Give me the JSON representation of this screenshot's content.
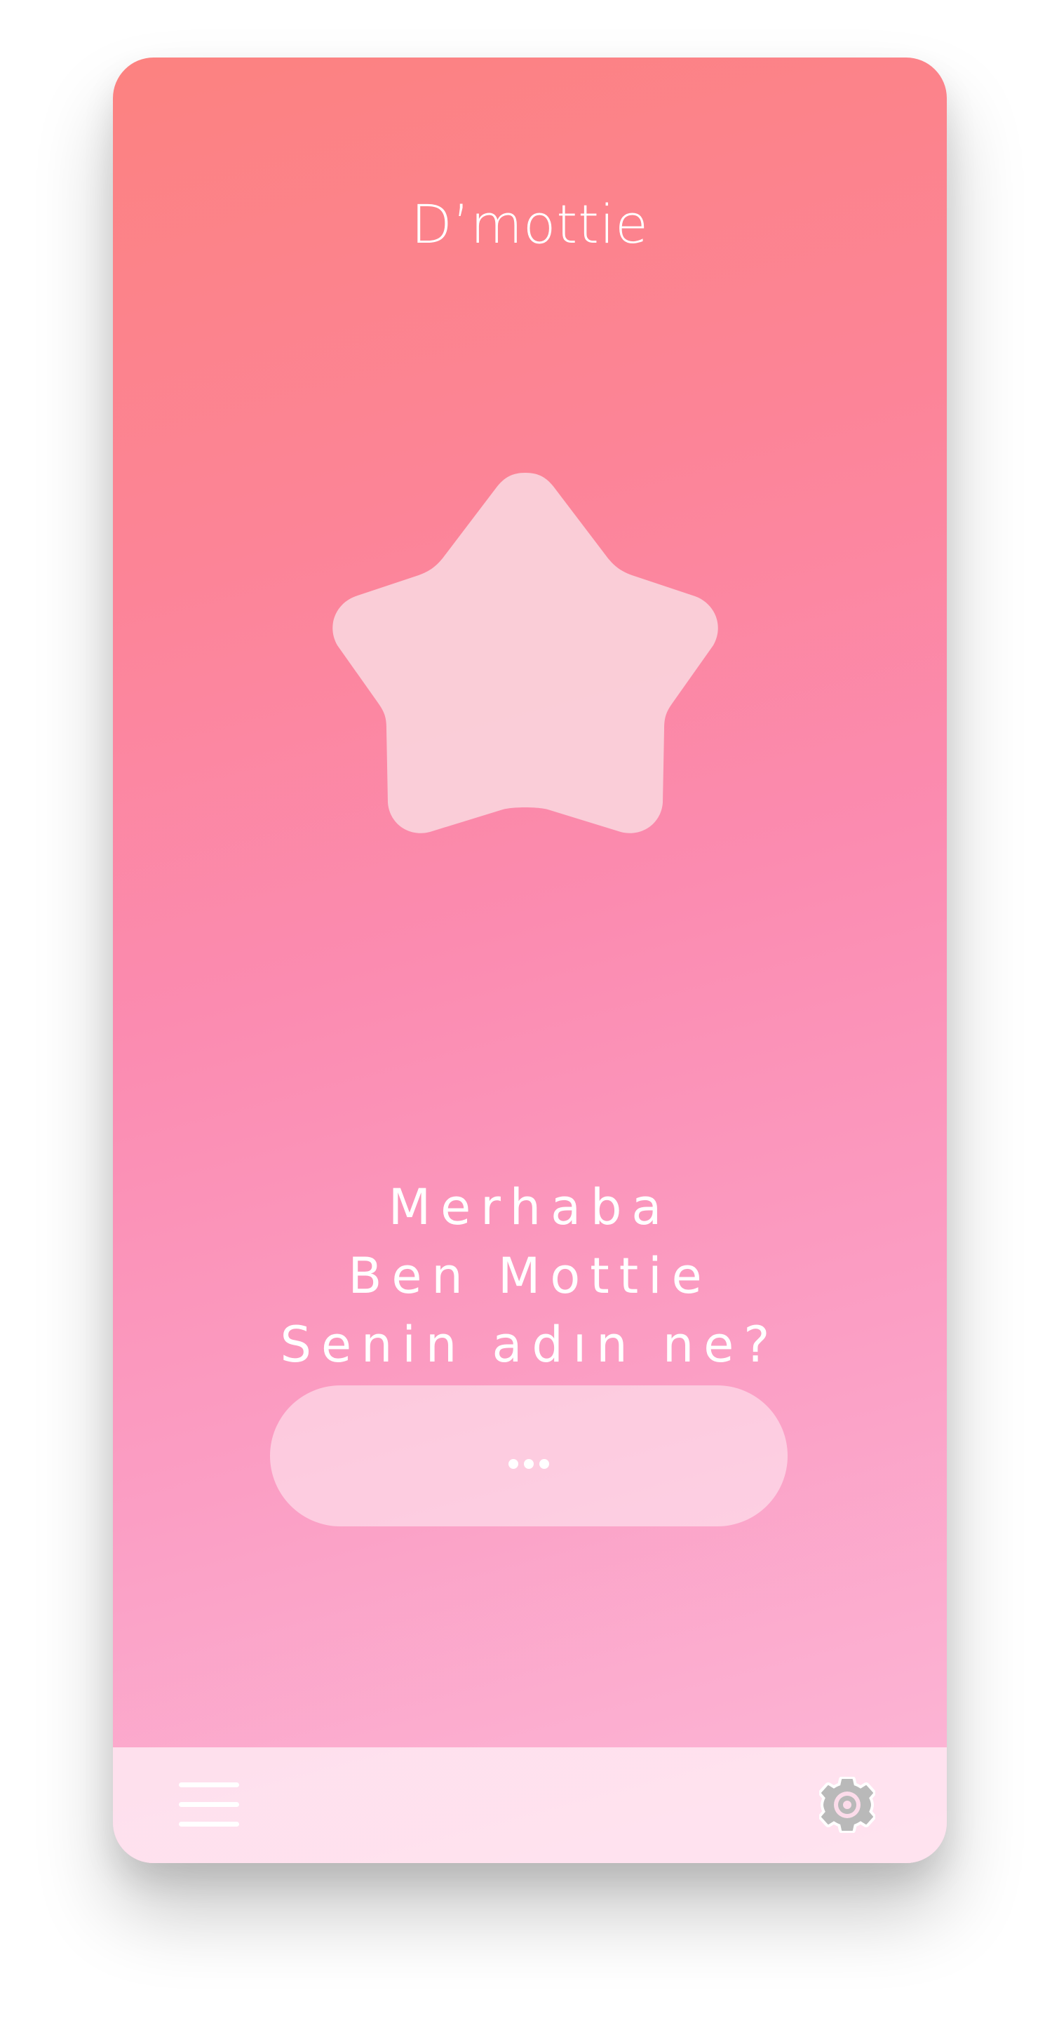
{
  "app": {
    "title": "D’mottie"
  },
  "mascot": {
    "icon": "star-icon"
  },
  "greeting": {
    "lines": [
      "Merhaba",
      "Ben Mottie",
      "Senin adın ne?"
    ]
  },
  "name_input": {
    "value": "",
    "placeholder_icon": "ellipsis-icon"
  },
  "bottom_bar": {
    "menu_icon": "hamburger-menu-icon",
    "settings_icon": "gear-icon"
  },
  "colors": {
    "gradient_top": "#fc8280",
    "gradient_bottom": "#fcb9d8",
    "star_fill": "#fad1da",
    "input_fill": "#fcc6dc",
    "bottom_bar": "#fcdcea",
    "gear_stroke": "#b9b9b9",
    "text": "#ffffff"
  }
}
